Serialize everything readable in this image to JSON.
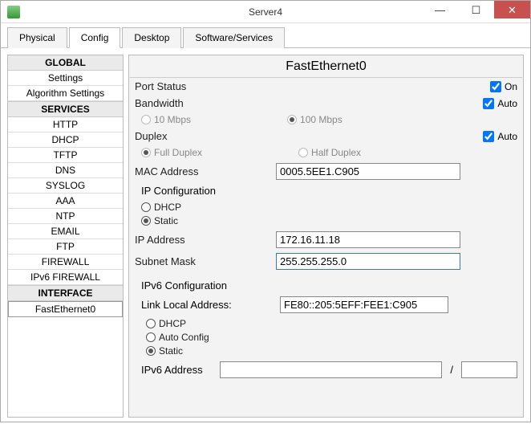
{
  "window": {
    "title": "Server4"
  },
  "tabs": {
    "physical": "Physical",
    "config": "Config",
    "desktop": "Desktop",
    "software": "Software/Services"
  },
  "sidebar": {
    "global": "GLOBAL",
    "settings": "Settings",
    "algorithm": "Algorithm Settings",
    "services": "SERVICES",
    "http": "HTTP",
    "dhcp": "DHCP",
    "tftp": "TFTP",
    "dns": "DNS",
    "syslog": "SYSLOG",
    "aaa": "AAA",
    "ntp": "NTP",
    "email": "EMAIL",
    "ftp": "FTP",
    "firewall": "FIREWALL",
    "ipv6fw": "IPv6 FIREWALL",
    "interface": "INTERFACE",
    "fe0": "FastEthernet0"
  },
  "panel": {
    "title": "FastEthernet0",
    "port_status": "Port Status",
    "on": "On",
    "bandwidth": "Bandwidth",
    "auto": "Auto",
    "bw10": "10 Mbps",
    "bw100": "100 Mbps",
    "duplex": "Duplex",
    "full": "Full Duplex",
    "half": "Half Duplex",
    "mac_lbl": "MAC Address",
    "mac": "0005.5EE1.C905",
    "ipcfg": "IP Configuration",
    "dhcp_opt": "DHCP",
    "static_opt": "Static",
    "ip_lbl": "IP Address",
    "ip": "172.16.11.18",
    "subnet_lbl": "Subnet Mask",
    "subnet": "255.255.255.0",
    "ipv6cfg": "IPv6 Configuration",
    "lla_lbl": "Link Local Address:",
    "lla": "FE80::205:5EFF:FEE1:C905",
    "autocfg": "Auto Config",
    "ipv6_lbl": "IPv6 Address",
    "ipv6": "",
    "ipv6_prefix": "",
    "slash": "/"
  }
}
